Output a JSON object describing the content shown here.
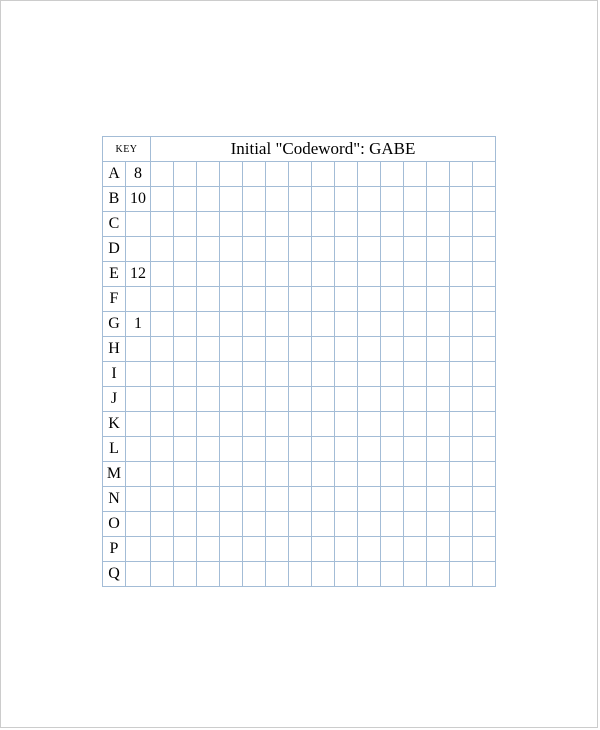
{
  "header": {
    "key_label": "KEY",
    "title": "Initial \"Codeword\": GABE"
  },
  "rows": [
    {
      "letter": "A",
      "value": "8"
    },
    {
      "letter": "B",
      "value": "10"
    },
    {
      "letter": "C",
      "value": ""
    },
    {
      "letter": "D",
      "value": ""
    },
    {
      "letter": "E",
      "value": "12"
    },
    {
      "letter": "F",
      "value": ""
    },
    {
      "letter": "G",
      "value": "1"
    },
    {
      "letter": "H",
      "value": ""
    },
    {
      "letter": "I",
      "value": ""
    },
    {
      "letter": "J",
      "value": ""
    },
    {
      "letter": "K",
      "value": ""
    },
    {
      "letter": "L",
      "value": ""
    },
    {
      "letter": "M",
      "value": ""
    },
    {
      "letter": "N",
      "value": ""
    },
    {
      "letter": "O",
      "value": ""
    },
    {
      "letter": "P",
      "value": ""
    },
    {
      "letter": "Q",
      "value": ""
    }
  ],
  "grid_columns": 15
}
